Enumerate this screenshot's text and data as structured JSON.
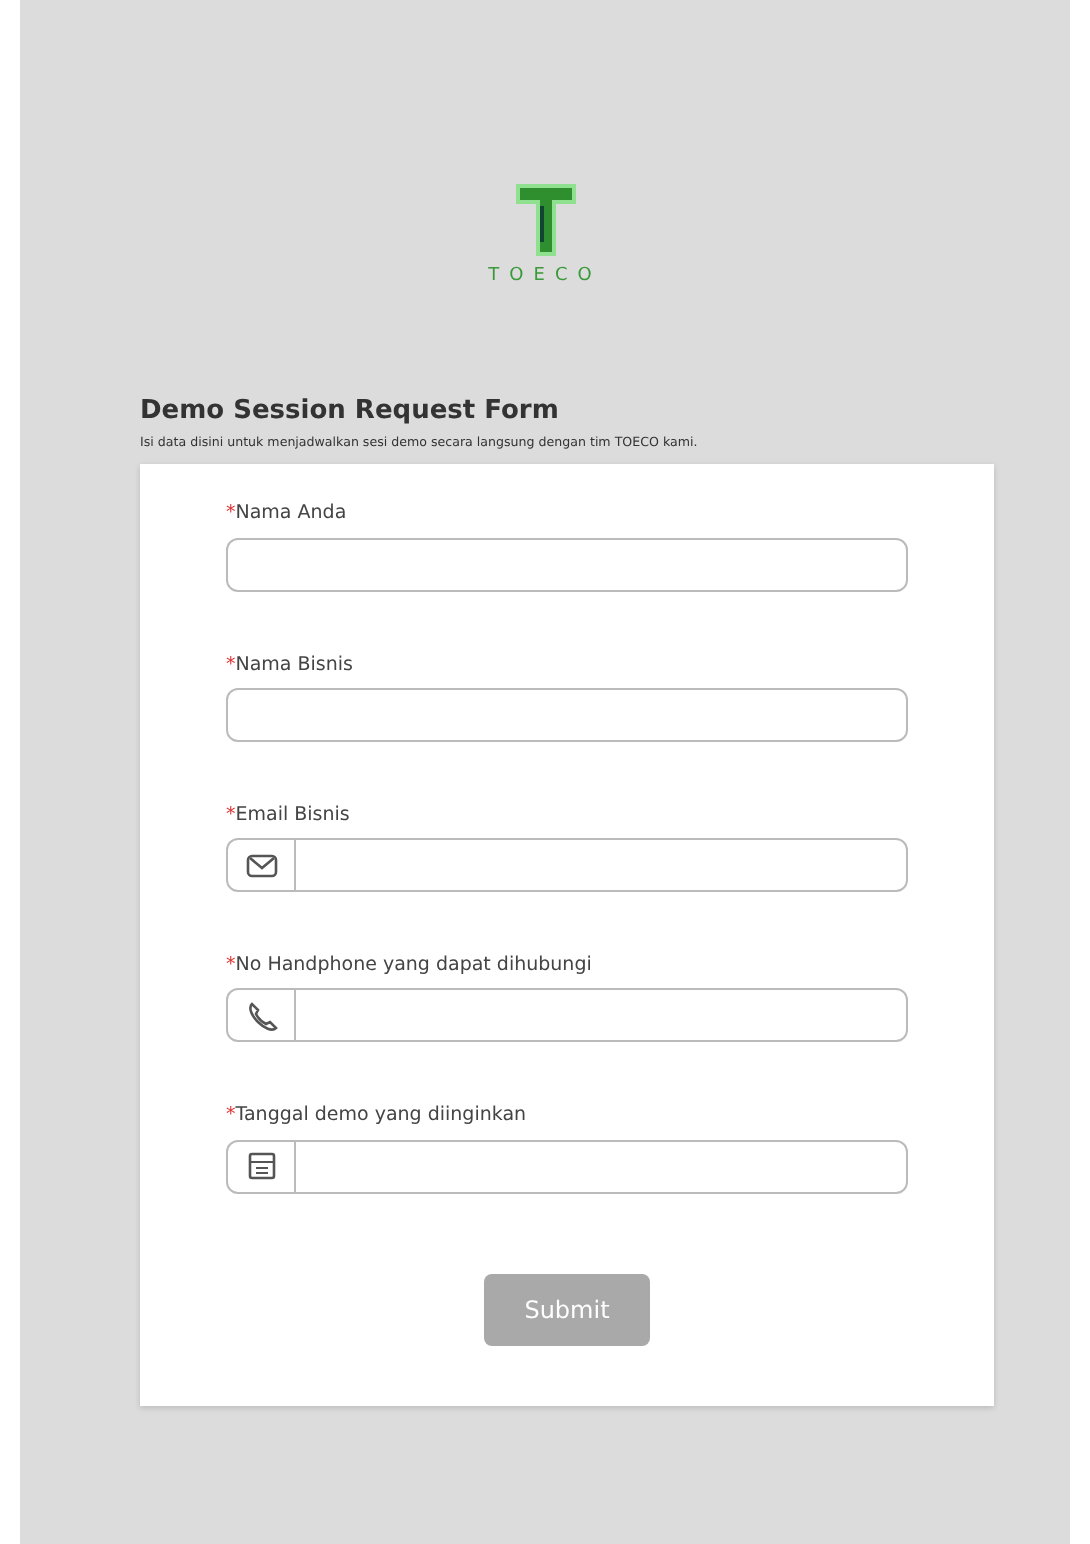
{
  "logo": {
    "text": "TOECO"
  },
  "form": {
    "title": "Demo Session Request Form",
    "subtitle": "Isi data disini untuk menjadwalkan sesi demo secara langsung dengan tim TOECO kami.",
    "fields": [
      {
        "required_mark": "*",
        "label": "Nama Anda",
        "kind": "text"
      },
      {
        "required_mark": "*",
        "label": "Nama Bisnis",
        "kind": "text"
      },
      {
        "required_mark": "*",
        "label": "Email Bisnis",
        "kind": "email"
      },
      {
        "required_mark": "*",
        "label": "No Handphone yang dapat dihubungi",
        "kind": "phone"
      },
      {
        "required_mark": "*",
        "label": "Tanggal demo yang diinginkan",
        "kind": "date"
      }
    ],
    "submit": {
      "label": "Submit",
      "disabled": true
    }
  }
}
